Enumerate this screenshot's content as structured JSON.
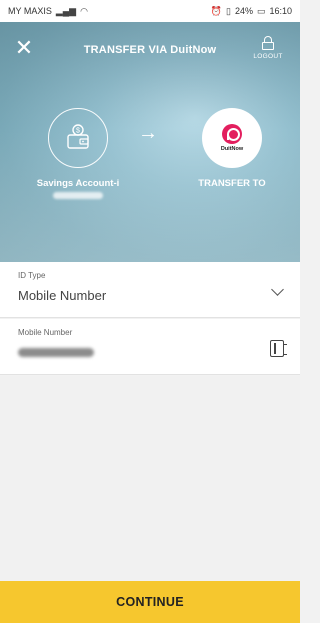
{
  "status_bar": {
    "carrier": "MY MAXIS",
    "battery": "24%",
    "time": "16:10"
  },
  "header": {
    "title": "TRANSFER VIA DuitNow",
    "close_icon": "close-icon",
    "logout_label": "LOGOUT",
    "logout_icon": "lock-icon"
  },
  "from_account": {
    "name": "Savings Account-i",
    "icon": "wallet-icon"
  },
  "to_account": {
    "logo_text": "DuitNow",
    "label": "TRANSFER TO"
  },
  "form": {
    "id_type": {
      "label": "ID Type",
      "value": "Mobile Number"
    },
    "mobile_number": {
      "label": "Mobile Number",
      "icon": "contacts-book-icon"
    }
  },
  "actions": {
    "continue_label": "CONTINUE"
  },
  "colors": {
    "accent": "#f6c72e",
    "duitnow_brand": "#e31e5e",
    "hero_tint": "#94c0cf"
  }
}
